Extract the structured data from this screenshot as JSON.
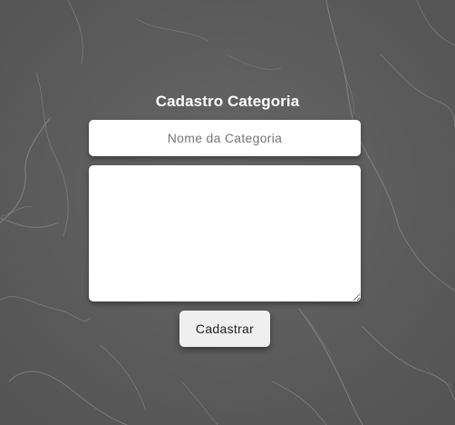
{
  "form": {
    "title": "Cadastro Categoria",
    "name_input": {
      "value": "",
      "placeholder": "Nome da Categoria"
    },
    "description_textarea": {
      "value": ""
    },
    "submit_label": "Cadastrar"
  },
  "theme": {
    "background": "#5e5e5e",
    "field_background": "#ffffff",
    "button_background": "#efefef",
    "title_color": "#ffffff"
  }
}
